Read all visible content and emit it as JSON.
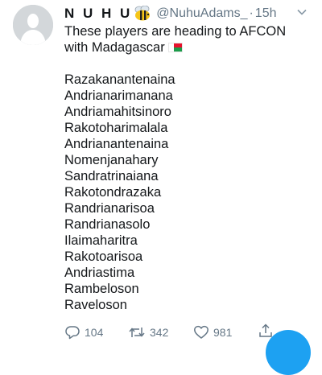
{
  "tweet": {
    "display_name": "N U H U",
    "handle": "@NuhuAdams_",
    "separator": "·",
    "time": "15h",
    "text_line1": "These players are heading to AFCON",
    "text_line2": "with Madagascar",
    "players": [
      "Razakanantenaina",
      "Andrianarimanana",
      "Andriamahitsinoro",
      "Rakotoharimalala",
      "Andrianantenaina",
      "Nomenjanahary",
      "Sandratrinaiana",
      "Rakotondrazaka",
      "Randrianarisoa",
      "Randrianasolo",
      "Ilaimaharitra",
      "Rakotoarisoa",
      "Andriastima",
      "Rambeloson",
      "Raveloson"
    ],
    "stats": {
      "replies": "104",
      "retweets": "342",
      "likes": "981"
    }
  },
  "colors": {
    "text": "#14171a",
    "muted": "#657786",
    "accent": "#1da1f2"
  },
  "icons": {
    "avatar": "default-profile-icon",
    "emoji": "bee-icon",
    "flag": "madagascar-flag-icon",
    "caret": "chevron-down-icon",
    "reply": "reply-icon",
    "retweet": "retweet-icon",
    "like": "heart-icon",
    "share": "share-icon"
  }
}
